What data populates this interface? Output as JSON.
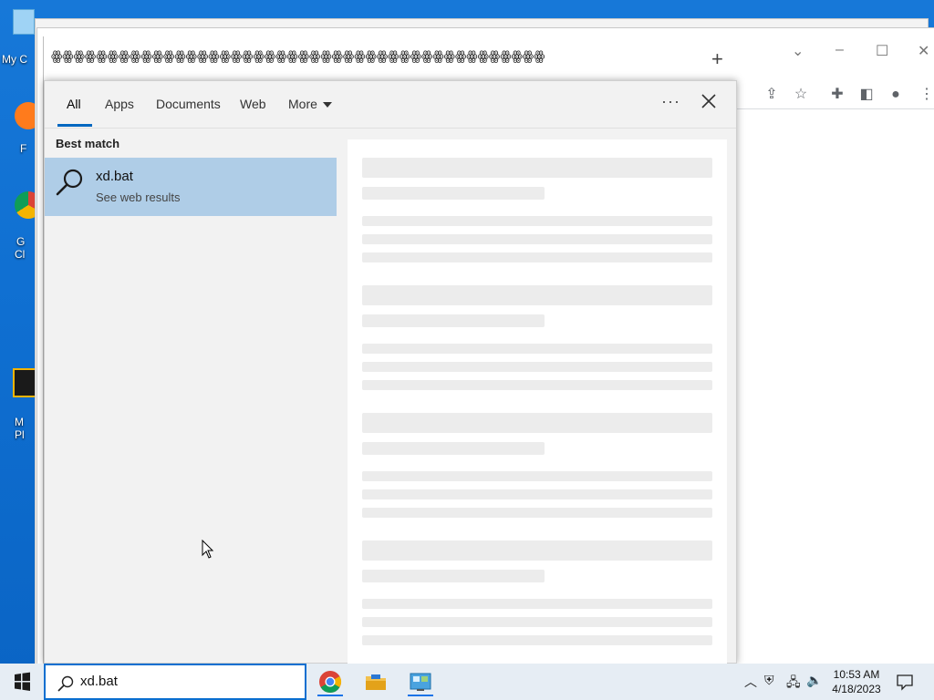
{
  "desktop": {
    "labels": [
      "My C",
      "F",
      "G",
      "Cl",
      "M",
      "Pl"
    ]
  },
  "chrome": {
    "tab_title": "ꙮꙮꙮꙮꙮꙮꙮꙮꙮꙮꙮꙮꙮꙮꙮꙮꙮꙮꙮꙮꙮꙮꙮꙮꙮꙮꙮꙮꙮꙮꙮꙮꙮꙮꙮꙮꙮꙮꙮꙮꙮꙮꙮꙮ",
    "new_tab": "+",
    "toolbar_icons": [
      "share-icon",
      "star-icon",
      "extensions-icon",
      "side-panel-icon",
      "profile-icon",
      "menu-icon"
    ]
  },
  "search_panel": {
    "tabs": [
      {
        "label": "All",
        "active": true
      },
      {
        "label": "Apps",
        "active": false
      },
      {
        "label": "Documents",
        "active": false
      },
      {
        "label": "Web",
        "active": false
      },
      {
        "label": "More",
        "active": false
      }
    ],
    "options_label": "···",
    "section_title": "Best match",
    "result": {
      "title": "xd.bat",
      "subtitle": "See web results"
    }
  },
  "taskbar": {
    "search_value": "xd.bat",
    "apps": [
      "chrome-icon",
      "file-explorer-icon",
      "control-panel-icon"
    ],
    "clock_time": "10:53 AM",
    "clock_date": "4/18/2023"
  },
  "colors": {
    "accent": "#0067c0",
    "selection": "#afcde7",
    "desktop": "#0f6fd1"
  }
}
